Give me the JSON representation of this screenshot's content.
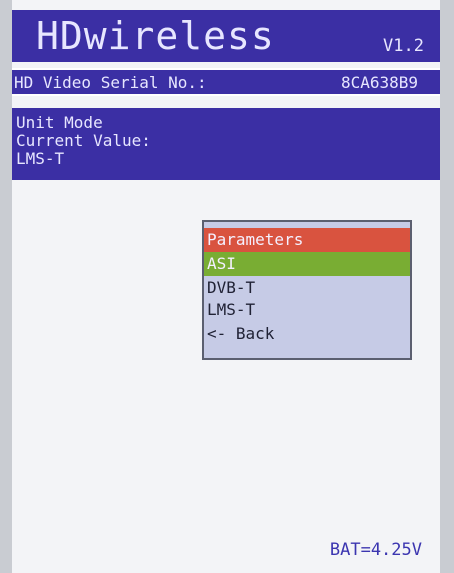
{
  "header": {
    "title": "HDwireless",
    "version": "V1.2"
  },
  "serial": {
    "label": "HD Video Serial No.:",
    "value": "8CA638B9"
  },
  "mode_panel": {
    "line1": "Unit Mode",
    "line2": "Current Value:",
    "line3": "LMS-T"
  },
  "menu": {
    "title": "Parameters",
    "items": [
      {
        "label": "ASI",
        "selected": true
      },
      {
        "label": "DVB-T",
        "selected": false
      },
      {
        "label": "LMS-T",
        "selected": false
      },
      {
        "label": "<- Back",
        "selected": false
      }
    ]
  },
  "status": {
    "battery": "BAT=4.25V"
  },
  "colors": {
    "header_bg": "#3b2fa4",
    "menu_title_bg": "#d9533f",
    "menu_selected_bg": "#79ad33",
    "menu_bg": "#c6cbe6"
  }
}
